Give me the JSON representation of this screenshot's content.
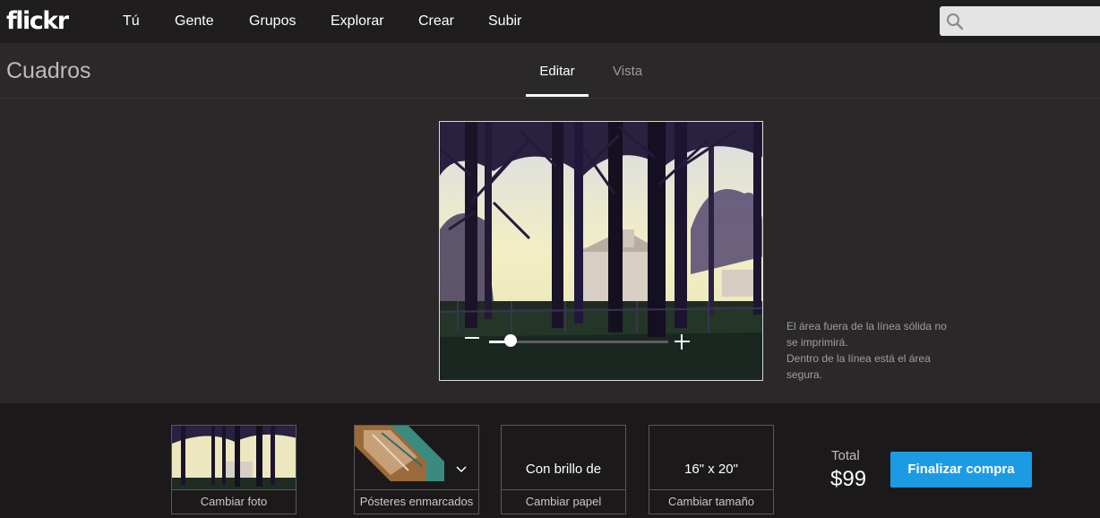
{
  "header": {
    "logo": "flickr",
    "nav": [
      "Tú",
      "Gente",
      "Grupos",
      "Explorar",
      "Crear",
      "Subir"
    ],
    "search_placeholder": ""
  },
  "subheader": {
    "title": "Cuadros",
    "tabs": [
      {
        "label": "Editar",
        "active": true
      },
      {
        "label": "Vista",
        "active": false
      }
    ]
  },
  "editor": {
    "zoom_level": 0.12,
    "safe_area_note": [
      "El área fuera de la línea sólida no",
      "se imprimirá.",
      "Dentro de la línea está el área",
      "segura."
    ]
  },
  "options": {
    "photo": {
      "caption": "Cambiar foto"
    },
    "product": {
      "caption": "Pósteres enmarcados"
    },
    "paper": {
      "value": "Con brillo de",
      "caption": "Cambiar papel"
    },
    "size": {
      "value": "16\" x 20\"",
      "caption": "Cambiar tamaño"
    }
  },
  "checkout": {
    "total_label": "Total",
    "total_price": "$99",
    "button_label": "Finalizar compra"
  },
  "colors": {
    "accent": "#1c9be4",
    "background": "#2a2829",
    "topbar": "#1f1d1e"
  }
}
